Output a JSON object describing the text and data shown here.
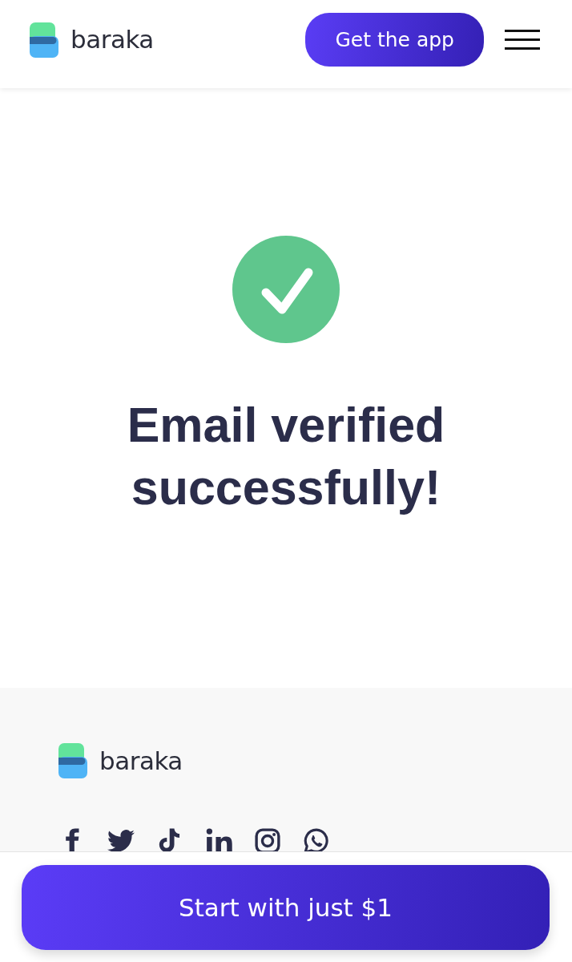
{
  "header": {
    "logo": {
      "text": "baraka"
    },
    "get_app_button": "Get the app"
  },
  "verification": {
    "title": "Email verified successfully!"
  },
  "footer": {
    "logo": {
      "text": "baraka"
    }
  },
  "cta_button": "Start with just $1"
}
